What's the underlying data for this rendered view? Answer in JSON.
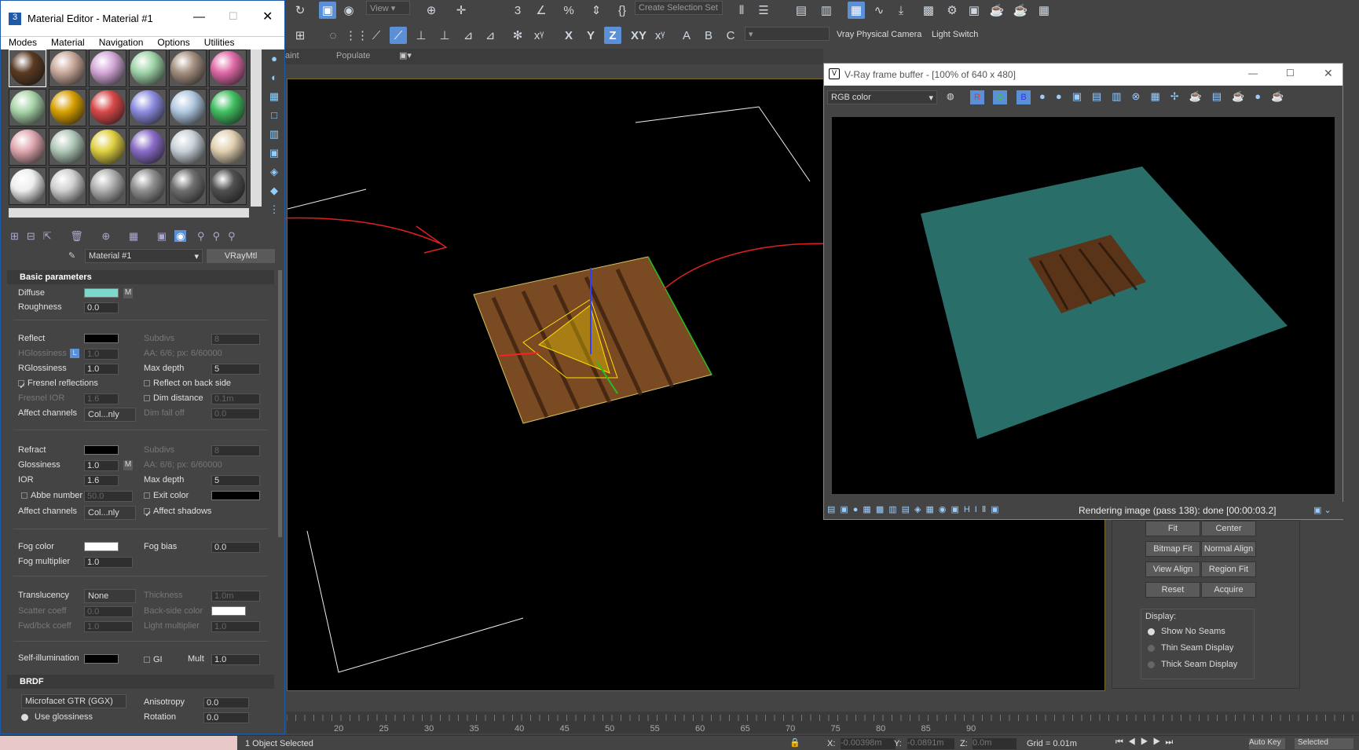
{
  "toolbar": {
    "view_label": "View",
    "selection_set_placeholder": "Create Selection Set",
    "camera_label": "Vray Physical Camera",
    "light_switch_label": "Light Switch",
    "ribbon_paint": "aint",
    "ribbon_populate": "Populate"
  },
  "material_editor": {
    "title": "Material Editor - Material #1",
    "menu": [
      "Modes",
      "Material",
      "Navigation",
      "Options",
      "Utilities"
    ],
    "material_name": "Material #1",
    "material_type": "VRayMtl",
    "basic_header": "Basic parameters",
    "diffuse_label": "Diffuse",
    "diffuse_color": "#7dd8cc",
    "map_label": "M",
    "roughness_label": "Roughness",
    "roughness_value": "0.0",
    "reflect_label": "Reflect",
    "subdivs_label": "Subdivs",
    "subdivs_value": "8",
    "hglossiness_label": "HGlossiness",
    "l_label": "L",
    "hglossiness_value": "1.0",
    "aa_text": "AA: 6/6; px: 6/60000",
    "rglossiness_label": "RGlossiness",
    "rglossiness_value": "1.0",
    "max_depth_label": "Max depth",
    "max_depth_value": "5",
    "fresnel_label": "Fresnel reflections",
    "reflect_back_label": "Reflect on back side",
    "fresnel_ior_label": "Fresnel IOR",
    "fresnel_ior_value": "1.6",
    "dim_distance_label": "Dim distance",
    "dim_distance_value": "0.1m",
    "affect_channels_label": "Affect channels",
    "affect_channels_value": "Col...nly",
    "dim_falloff_label": "Dim fall off",
    "dim_falloff_value": "0.0",
    "refract_label": "Refract",
    "glossiness_label": "Glossiness",
    "glossiness_value": "1.0",
    "ior_label": "IOR",
    "ior_value": "1.6",
    "abbe_label": "Abbe number",
    "abbe_value": "50.0",
    "exit_color_label": "Exit color",
    "affect_shadows_label": "Affect shadows",
    "fog_color_label": "Fog color",
    "fog_bias_label": "Fog bias",
    "fog_bias_value": "0.0",
    "fog_mult_label": "Fog multiplier",
    "fog_mult_value": "1.0",
    "translucency_label": "Translucency",
    "translucency_value": "None",
    "thickness_label": "Thickness",
    "thickness_value": "1.0m",
    "scatter_label": "Scatter coeff",
    "scatter_value": "0.0",
    "backside_label": "Back-side color",
    "fwd_label": "Fwd/bck coeff",
    "fwd_value": "1.0",
    "light_mult_label": "Light multiplier",
    "light_mult_value": "1.0",
    "self_illum_label": "Self-illumination",
    "gi_label": "GI",
    "mult_label": "Mult",
    "mult_value": "1.0",
    "brdf_header": "BRDF",
    "brdf_type": "Microfacet GTR (GGX)",
    "anisotropy_label": "Anisotropy",
    "anisotropy_value": "0.0",
    "use_gloss_label": "Use glossiness",
    "rotation_label": "Rotation",
    "rotation_value": "0.0",
    "sample_colors": [
      "#5a3a22",
      "#c9a99a",
      "#d4a8d8",
      "#9fd4a8",
      "#a59080",
      "#e06aa8",
      "#a8d4a8",
      "#d8a000",
      "#d84848",
      "#8c8ce0",
      "#b0c8e0",
      "#40c060",
      "#e0a8b0",
      "#b0c8b8",
      "#e0d040",
      "#8a6cc8",
      "#c8d0d8",
      "#e0d0b0",
      "#eeeeee",
      "#d0d0d0",
      "#b0b0b0",
      "#909090",
      "#707070",
      "#505050"
    ]
  },
  "vfb": {
    "title": "V-Ray frame buffer - [100% of 640 x 480]",
    "channel": "RGB color",
    "status": "Rendering image (pass 138): done [00:00:03.2]",
    "r": "R",
    "g": "G",
    "b": "B"
  },
  "uvw_panel": {
    "buttons": [
      "Fit",
      "Center",
      "Bitmap Fit",
      "Normal Align",
      "View Align",
      "Region Fit",
      "Reset",
      "Acquire"
    ],
    "display_label": "Display:",
    "display_options": [
      "Show No Seams",
      "Thin Seam Display",
      "Thick Seam Display"
    ],
    "selected": 0
  },
  "timeline": {
    "ticks": [
      "20",
      "25",
      "30",
      "35",
      "40",
      "45",
      "50",
      "55",
      "60",
      "65",
      "70",
      "75",
      "80",
      "85",
      "90"
    ]
  },
  "status": {
    "selection": "1 Object Selected",
    "x_label": "X:",
    "x_value": "-0.00398m",
    "y_label": "Y:",
    "y_value": "-0.0891m",
    "z_label": "Z:",
    "z_value": "0.0m",
    "grid": "Grid = 0.01m",
    "auto_key": "Auto Key",
    "selected": "Selected"
  },
  "axis_labels": {
    "x": "X",
    "y": "Y",
    "z": "Z",
    "xy": "XY"
  }
}
